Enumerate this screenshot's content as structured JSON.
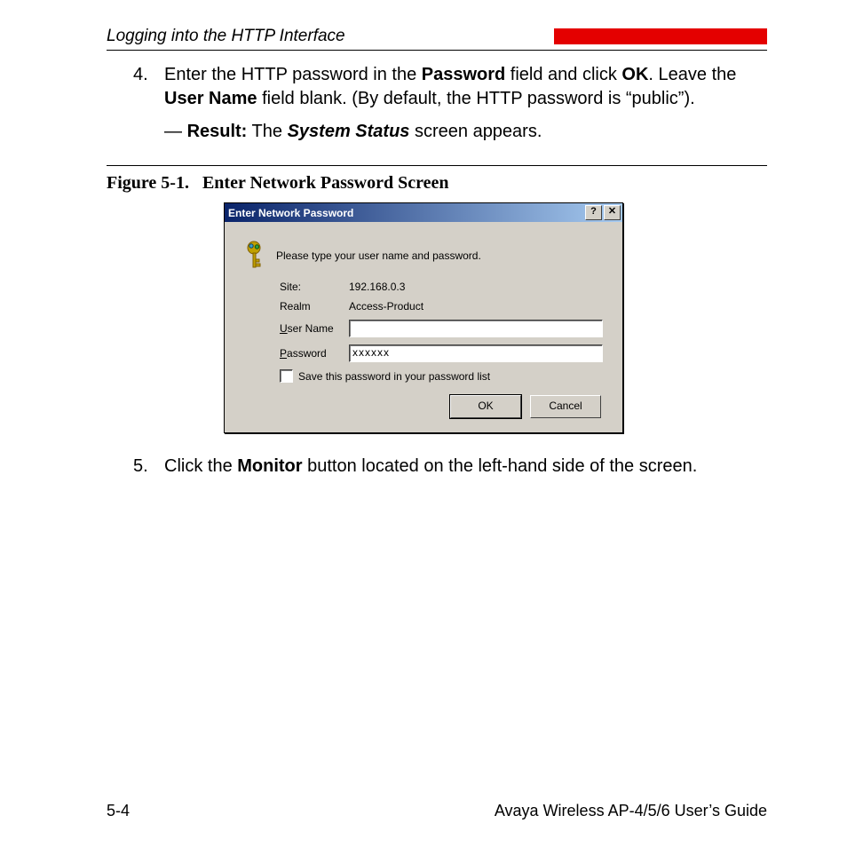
{
  "header": {
    "title": "Logging into the HTTP Interface"
  },
  "steps": {
    "item4": {
      "number": "4.",
      "text_parts": {
        "t1": "Enter the HTTP password in the ",
        "b1": "Password",
        "t2": " field and click ",
        "b2": "OK",
        "t3": ". Leave the ",
        "b3": "User Name",
        "t4": " field blank. (By default, the HTTP password is “public”)."
      },
      "result": {
        "dash": "— ",
        "label": "Result:",
        "t1": " The ",
        "emph": "System Status",
        "t2": " screen appears."
      }
    },
    "item5": {
      "number": "5.",
      "text_parts": {
        "t1": "Click the ",
        "b1": "Monitor",
        "t2": " button located on the left-hand side of the screen."
      }
    }
  },
  "figure": {
    "caption_prefix": "Figure 5-1.",
    "caption_title": "Enter Network Password Screen"
  },
  "dialog": {
    "title": "Enter Network Password",
    "help_symbol": "?",
    "close_symbol": "✕",
    "prompt": "Please type your user name and password.",
    "labels": {
      "site": "Site:",
      "realm": "Realm",
      "user_name_pre": "U",
      "user_name_rest": "ser Name",
      "password_pre": "P",
      "password_rest": "assword",
      "save_pre": "S",
      "save_rest": "ave this password in your password list"
    },
    "values": {
      "site": "192.168.0.3",
      "realm": "Access-Product",
      "user_name": "",
      "password": "xxxxxx"
    },
    "buttons": {
      "ok": "OK",
      "cancel": "Cancel"
    }
  },
  "footer": {
    "page": "5-4",
    "book": "Avaya Wireless AP-4/5/6 User’s Guide"
  }
}
